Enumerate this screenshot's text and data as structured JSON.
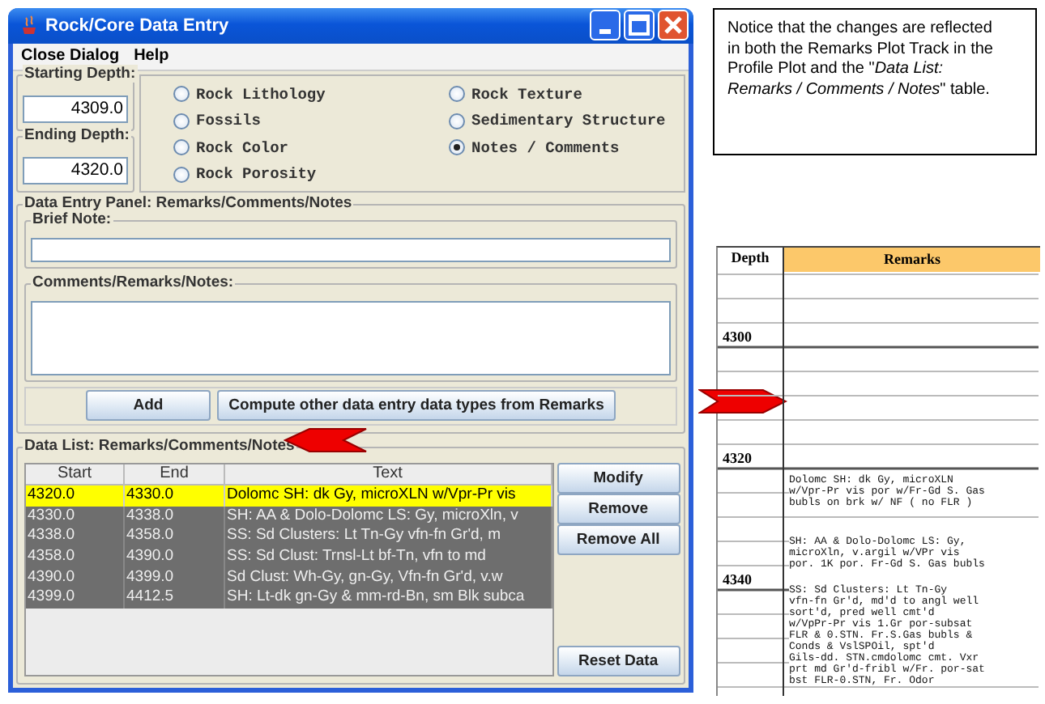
{
  "window": {
    "title": "Rock/Core Data Entry"
  },
  "menu": [
    {
      "label": "Close Dialog"
    },
    {
      "label": "Help"
    }
  ],
  "depth": [
    {
      "label": "Starting Depth:",
      "value": "4309.0"
    },
    {
      "label": "Ending Depth:",
      "value": "4320.0"
    }
  ],
  "data_types": [
    {
      "label": "Rock Lithology",
      "selected": false
    },
    {
      "label": "Rock Texture",
      "selected": false
    },
    {
      "label": "Fossils",
      "selected": false
    },
    {
      "label": "Sedimentary Structure",
      "selected": false
    },
    {
      "label": "Rock Color",
      "selected": false
    },
    {
      "label": "Notes / Comments",
      "selected": true
    },
    {
      "label": "Rock Porosity",
      "selected": false
    }
  ],
  "entry_panel": {
    "title": "Data Entry Panel: Remarks/Comments/Notes",
    "brief_note_label": "Brief Note:",
    "comments_label": "Comments/Remarks/Notes:",
    "buttons": [
      "Add",
      "Compute other data entry data types from Remarks"
    ]
  },
  "data_list": {
    "title": "Data List: Remarks/Comments/Notes",
    "columns": [
      "Start",
      "End",
      "Text"
    ],
    "rows": [
      {
        "start": "4320.0",
        "end": "4330.0",
        "text": "Dolomc SH: dk Gy, microXLN w/Vpr-Pr vis",
        "selected": true
      },
      {
        "start": "4330.0",
        "end": "4338.0",
        "text": "SH: AA & Dolo-Dolomc LS: Gy, microXln, v",
        "selected": false
      },
      {
        "start": "4338.0",
        "end": "4358.0",
        "text": "SS: Sd Clusters: Lt Tn-Gy vfn-fn Gr'd, m",
        "selected": false
      },
      {
        "start": "4358.0",
        "end": "4390.0",
        "text": "SS: Sd Clust: Trnsl-Lt bf-Tn, vfn to md",
        "selected": false
      },
      {
        "start": "4390.0",
        "end": "4399.0",
        "text": "Sd Clust: Wh-Gy, gn-Gy, Vfn-fn Gr'd, v.w",
        "selected": false
      },
      {
        "start": "4399.0",
        "end": "4412.5",
        "text": "SH: Lt-dk gn-Gy & mm-rd-Bn, sm Blk subca",
        "selected": false
      }
    ],
    "buttons": [
      "Modify",
      "Remove",
      "Remove All"
    ],
    "reset_button": "Reset Data"
  },
  "callout": {
    "text": "Notice that the changes are reflected in both the Remarks Plot Track in the Profile Plot and the \"*Data List: Remarks / Comments / Notes*\" table."
  },
  "profile_plot": {
    "columns": [
      "Depth",
      "Remarks"
    ],
    "depth_labels": [
      "4300",
      "4320",
      "4340"
    ],
    "remarks": [
      "Dolomc SH: dk Gy, microXLN\nw/Vpr-Pr vis por w/Fr-Gd S. Gas\nbubls on brk w/ NF ( no FLR )",
      "SH: AA & Dolo-Dolomc LS: Gy,\nmicroXln, v.argil w/VPr vis\npor. 1K por. Fr-Gd S. Gas bubls",
      "SS: Sd Clusters: Lt Tn-Gy\nvfn-fn Gr'd, md'd to angl well\nsort'd, pred well cmt'd\nw/VpPr-Pr vis 1.Gr por-subsat\nFLR & 0.STN. Fr.S.Gas bubls &\nConds & VslSPOil, spt'd\nGils-dd. STN.cmdolomc cmt. Vxr\nprt md Gr'd-fribl w/Fr. por-sat\nbst FLR-0.STN, Fr. Odor"
    ]
  }
}
